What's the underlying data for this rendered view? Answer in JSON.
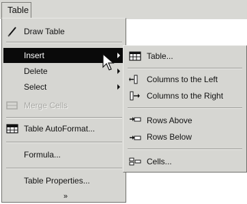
{
  "menubar": {
    "title": "Table",
    "title_mnemonic": "a"
  },
  "main_menu": {
    "items": [
      {
        "label": "Draw Table",
        "icon": "pencil-icon",
        "submenu": false,
        "state": "normal"
      },
      {
        "label": "Insert",
        "icon": "",
        "submenu": true,
        "state": "active"
      },
      {
        "label": "Delete",
        "icon": "",
        "submenu": true,
        "state": "normal"
      },
      {
        "label": "Select",
        "icon": "",
        "submenu": true,
        "state": "normal"
      },
      {
        "label": "Merge Cells",
        "icon": "merge-cells-icon",
        "submenu": false,
        "state": "disabled"
      },
      {
        "label": "Table AutoFormat...",
        "icon": "table-autoformat-icon",
        "submenu": false,
        "state": "normal"
      },
      {
        "label": "Formula...",
        "icon": "",
        "submenu": false,
        "state": "normal"
      },
      {
        "label": "Table Properties...",
        "icon": "",
        "submenu": false,
        "state": "normal"
      }
    ],
    "expand_glyph": "»"
  },
  "insert_submenu": {
    "items": [
      {
        "label": "Table...",
        "icon": "insert-table-icon"
      },
      {
        "label": "Columns to the Left",
        "icon": "columns-left-icon"
      },
      {
        "label": "Columns to the Right",
        "icon": "columns-right-icon"
      },
      {
        "label": "Rows Above",
        "icon": "rows-above-icon"
      },
      {
        "label": "Rows Below",
        "icon": "rows-below-icon"
      },
      {
        "label": "Cells...",
        "icon": "insert-cells-icon"
      }
    ]
  },
  "colors": {
    "menu_face": "#d6d6d2",
    "highlight": "#0a0a0a",
    "highlight_text": "#ffffff",
    "disabled_text": "#a8a8a4"
  }
}
